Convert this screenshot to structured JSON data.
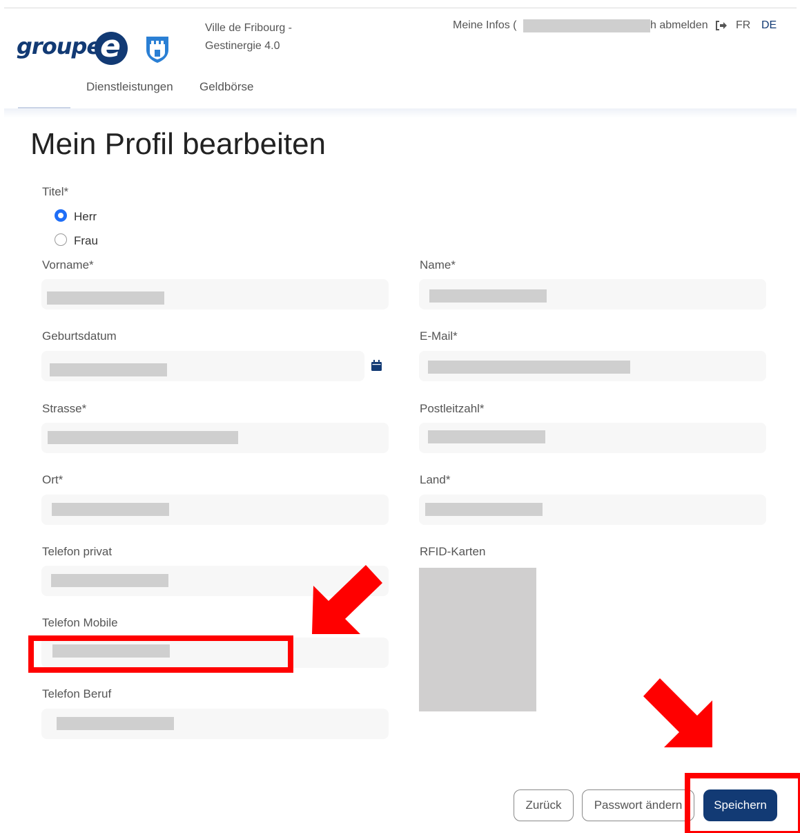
{
  "header": {
    "logo_text": "groupe",
    "logo_letter": "e",
    "site_title_line1": "Ville de Fribourg -",
    "site_title_line2": "Gestinergie 4.0",
    "meine_infos": "Meine Infos (",
    "abmelden": "h abmelden",
    "lang_fr": "FR",
    "lang_de": "DE"
  },
  "nav": {
    "items": [
      {
        "label": "Dienstleistungen"
      },
      {
        "label": "Geldbörse"
      }
    ]
  },
  "page": {
    "title": "Mein Profil bearbeiten"
  },
  "form": {
    "titel_label": "Titel*",
    "options": [
      {
        "label": "Herr",
        "checked": true
      },
      {
        "label": "Frau",
        "checked": false
      }
    ],
    "vorname_label": "Vorname*",
    "name_label": "Name*",
    "geburtsdatum_label": "Geburtsdatum",
    "email_label": "E-Mail*",
    "strasse_label": "Strasse*",
    "plz_label": "Postleitzahl*",
    "ort_label": "Ort*",
    "land_label": "Land*",
    "tel_privat_label": "Telefon privat",
    "rfid_label": "RFID-Karten",
    "tel_mobile_label": "Telefon Mobile",
    "tel_beruf_label": "Telefon Beruf"
  },
  "buttons": {
    "back": "Zurück",
    "password": "Passwort ändern",
    "save": "Speichern"
  },
  "colors": {
    "brand": "#123a74",
    "radio_accent": "#1f6ef7",
    "annotation": "#ff0000"
  }
}
